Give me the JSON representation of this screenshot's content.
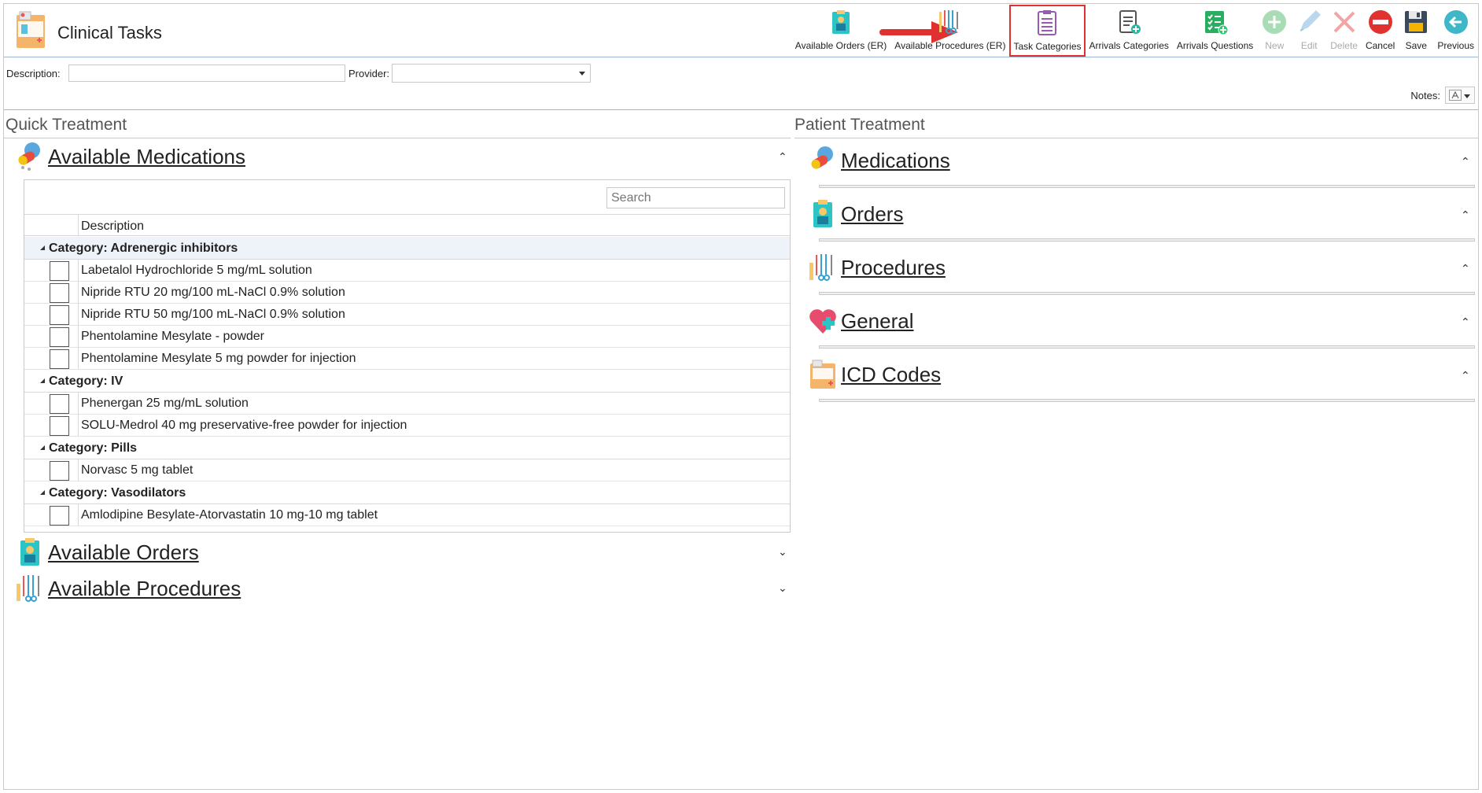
{
  "app": {
    "title": "Clinical Tasks"
  },
  "toolbar": [
    {
      "label": "Available Orders (ER)",
      "icon": "clipboard-doctor-icon",
      "disabled": false,
      "highlight": false
    },
    {
      "label": "Available Procedures (ER)",
      "icon": "surgical-tools-icon",
      "disabled": false,
      "highlight": false
    },
    {
      "label": "Task Categories",
      "icon": "task-list-icon",
      "disabled": false,
      "highlight": true
    },
    {
      "label": "Arrivals Categories",
      "icon": "clipboard-add-icon",
      "disabled": false,
      "highlight": false
    },
    {
      "label": "Arrivals Questions",
      "icon": "checklist-add-icon",
      "disabled": false,
      "highlight": false
    },
    {
      "label": "New",
      "icon": "plus-circle-icon",
      "disabled": true,
      "highlight": false
    },
    {
      "label": "Edit",
      "icon": "pencil-icon",
      "disabled": true,
      "highlight": false
    },
    {
      "label": "Delete",
      "icon": "x-icon",
      "disabled": true,
      "highlight": false
    },
    {
      "label": "Cancel",
      "icon": "cancel-icon",
      "disabled": false,
      "highlight": false
    },
    {
      "label": "Save",
      "icon": "floppy-disk-icon",
      "disabled": false,
      "highlight": false
    },
    {
      "label": "Previous",
      "icon": "arrow-left-circle-icon",
      "disabled": false,
      "highlight": false
    }
  ],
  "filters": {
    "description_label": "Description:",
    "description_value": "",
    "provider_label": "Provider:",
    "provider_value": "",
    "notes_label": "Notes:"
  },
  "quick_treatment": {
    "title": "Quick Treatment",
    "available_medications": {
      "title": "Available Medications",
      "search_placeholder": "Search",
      "column_header": "Description",
      "categories": [
        {
          "label": "Category: Adrenergic inhibitors",
          "items": [
            "Labetalol Hydrochloride 5 mg/mL solution",
            "Nipride RTU 20 mg/100 mL-NaCl 0.9% solution",
            "Nipride RTU 50 mg/100 mL-NaCl 0.9% solution",
            "Phentolamine Mesylate - powder",
            "Phentolamine Mesylate 5 mg powder for injection"
          ]
        },
        {
          "label": "Category: IV",
          "items": [
            "Phenergan 25 mg/mL solution",
            "SOLU-Medrol 40 mg preservative-free powder for injection"
          ]
        },
        {
          "label": "Category: Pills",
          "items": [
            "Norvasc 5 mg tablet"
          ]
        },
        {
          "label": "Category: Vasodilators",
          "items": [
            "Amlodipine Besylate-Atorvastatin 10 mg-10 mg tablet"
          ]
        }
      ]
    },
    "available_orders": {
      "title": "Available Orders"
    },
    "available_procedures": {
      "title": "Available Procedures"
    }
  },
  "patient_treatment": {
    "title": "Patient Treatment",
    "sections": [
      {
        "title": "Medications",
        "icon": "pills-icon"
      },
      {
        "title": "Orders",
        "icon": "clipboard-doctor-icon"
      },
      {
        "title": "Procedures",
        "icon": "surgical-tools-icon"
      },
      {
        "title": "General",
        "icon": "heart-plus-icon"
      },
      {
        "title": "ICD Codes",
        "icon": "folder-medical-icon"
      }
    ]
  },
  "colors": {
    "accent_border": "#9cb6d8",
    "highlight_red": "#e03030"
  }
}
